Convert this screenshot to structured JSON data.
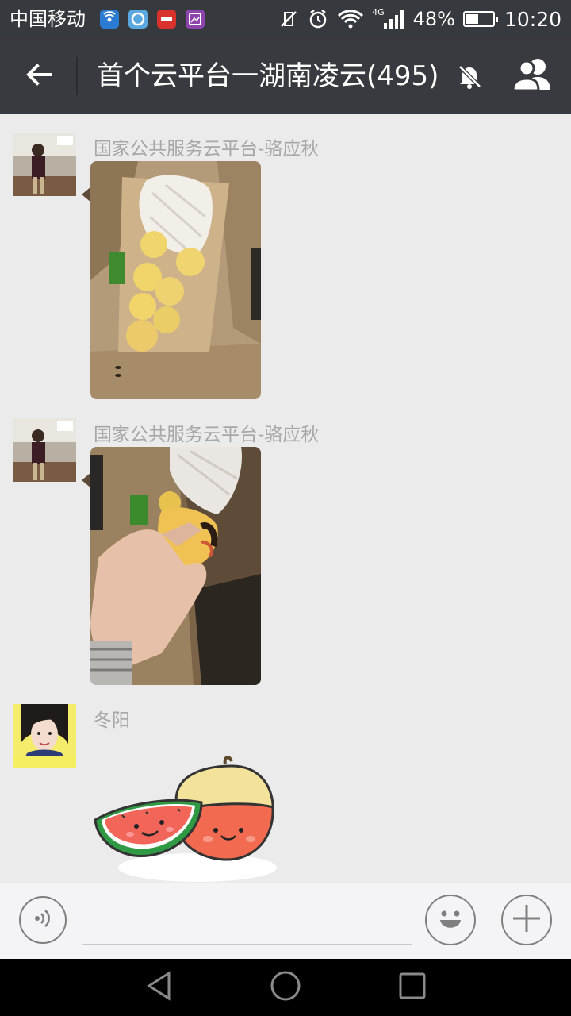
{
  "status_bar": {
    "carrier": "中国移动",
    "network": "4G",
    "battery_percent": "48%",
    "battery_level": 0.48,
    "time": "10:20",
    "icons": [
      "wifi-tether-icon",
      "browser-app-icon",
      "carrier-app-icon",
      "gallery-app-icon",
      "vibrate-off-icon",
      "alarm-icon",
      "wifi-icon",
      "signal-icon",
      "battery-icon"
    ]
  },
  "header": {
    "title": "首个云平台一湖南凌云(495)",
    "icons": [
      "back-arrow-icon",
      "mute-bell-icon",
      "members-icon"
    ]
  },
  "messages": [
    {
      "sender": "国家公共服务云平台-骆应秋",
      "type": "image",
      "content": "photo-pears-in-box"
    },
    {
      "sender": "国家公共服务云平台-骆应秋",
      "type": "image",
      "content": "photo-hand-holding-pear"
    },
    {
      "sender": "冬阳",
      "type": "sticker",
      "content": "watermelon-apple-sticker"
    }
  ],
  "input_bar": {
    "text": "",
    "icons": [
      "voice-icon",
      "emoji-icon",
      "plus-icon"
    ]
  },
  "nav_bar": {
    "icons": [
      "nav-back-icon",
      "nav-home-icon",
      "nav-recents-icon"
    ]
  },
  "colors": {
    "status_bar_bg": "#363a3e",
    "title_bar_bg": "#393a3f",
    "chat_bg": "#ebebeb",
    "sender_name": "#a7a7a7",
    "input_bar_bg": "#f4f4f6"
  }
}
